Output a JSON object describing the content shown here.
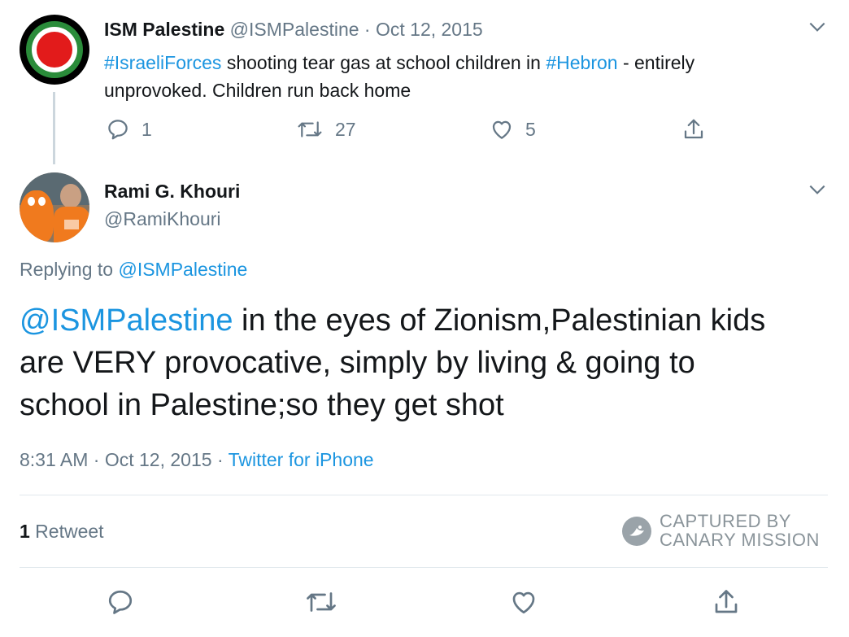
{
  "parent": {
    "display_name": "ISM Palestine",
    "handle": "@ISMPalestine",
    "separator": "·",
    "date": "Oct 12, 2015",
    "text": {
      "hashtag1": "#IsraeliForces",
      "part1": " shooting tear gas at school children in ",
      "hashtag2": "#Hebron",
      "part2": " - entirely",
      "line2": "unprovoked. Children run back home"
    },
    "actions": {
      "replies": "1",
      "retweets": "27",
      "likes": "5"
    }
  },
  "main": {
    "display_name": "Rami G. Khouri",
    "handle": "@RamiKhouri",
    "replying_prefix": "Replying to ",
    "replying_to": "@ISMPalestine",
    "text": {
      "mention": "@ISMPalestine",
      "line1_rest": " in the eyes of Zionism,Palestinian kids",
      "line2": "are VERY provocative, simply by living & going to",
      "line3": "school in Palestine;so they get shot"
    },
    "time": "8:31 AM",
    "sep1": "·",
    "date": "Oct 12, 2015",
    "sep2": "·",
    "source": "Twitter for iPhone",
    "retweet_count": "1",
    "retweet_label": " Retweet"
  },
  "watermark": {
    "line1": "CAPTURED BY",
    "line2": "CANARY MISSION"
  },
  "colors": {
    "link": "#1b95e0",
    "muted": "#657786",
    "divider": "#e1e8ed"
  },
  "icons": [
    "chevron-down-icon",
    "reply-icon",
    "retweet-icon",
    "like-icon",
    "share-icon",
    "canary-mission-logo-icon"
  ]
}
